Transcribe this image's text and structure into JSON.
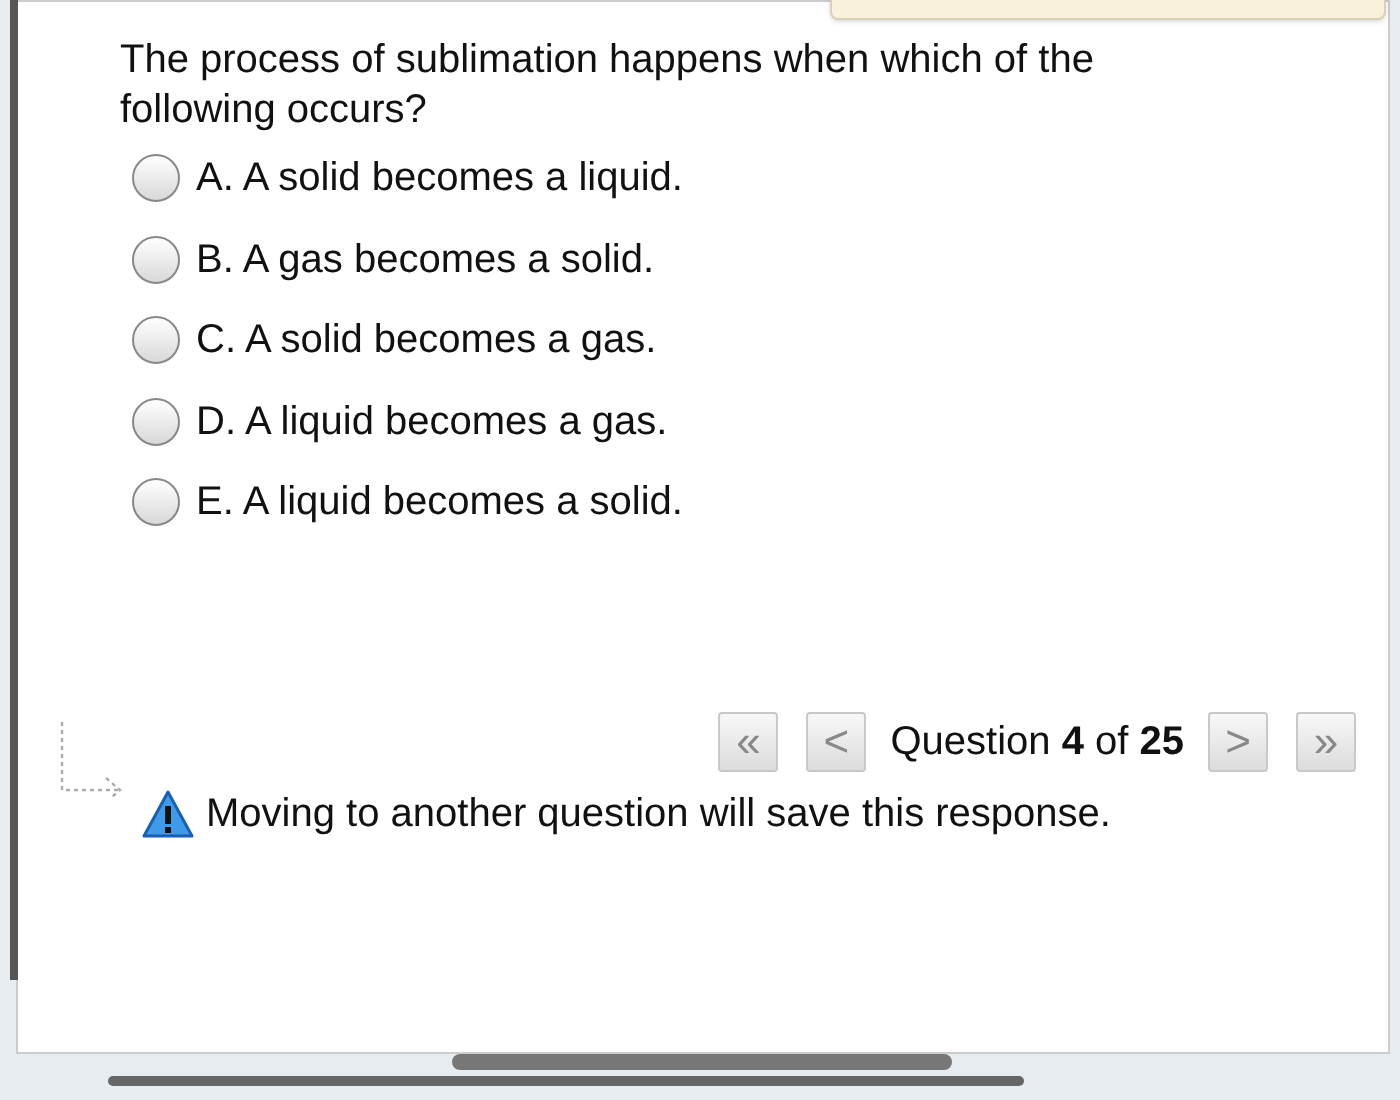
{
  "question": {
    "text": "The process of sublimation happens when which of the following occurs?"
  },
  "options": [
    {
      "label": "A. A solid becomes a liquid.",
      "selected": false
    },
    {
      "label": "B. A gas becomes a solid.",
      "selected": false
    },
    {
      "label": "C. A solid becomes a gas.",
      "selected": false
    },
    {
      "label": "D. A liquid becomes a gas.",
      "selected": false
    },
    {
      "label": "E. A liquid becomes a solid.",
      "selected": false
    }
  ],
  "navigation": {
    "first": "«",
    "previous": "<",
    "position": "Question **4** of **25**",
    "next": ">",
    "last": "»"
  },
  "notice": "Moving to another question will save this response."
}
